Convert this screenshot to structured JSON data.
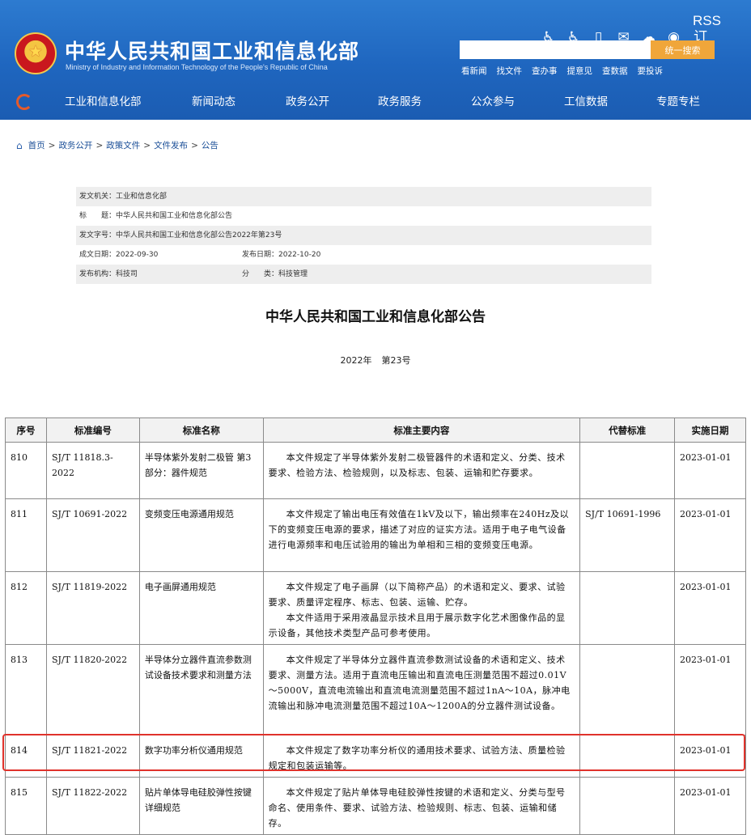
{
  "header": {
    "title": "中华人民共和国工业和信息化部",
    "subtitle": "Ministry of Industry and Information Technology of the People's Republic of China",
    "tool_icons": [
      "accessibility-icon",
      "wheelchair-icon",
      "mobile-icon",
      "mail-icon",
      "wechat-icon",
      "weibo-icon"
    ],
    "rss_label": "RSS订阅",
    "search_placeholder": "",
    "search_button": "统一搜索",
    "quick_links": [
      "看新闻",
      "找文件",
      "查办事",
      "提意见",
      "查数据",
      "要投诉"
    ],
    "nav": [
      "工业和信息化部",
      "新闻动态",
      "政务公开",
      "政务服务",
      "公众参与",
      "工信数据",
      "专题专栏"
    ]
  },
  "breadcrumb": [
    "首页",
    "政务公开",
    "政策文件",
    "文件发布",
    "公告"
  ],
  "meta": {
    "issuer": "发文机关：工业和信息化部",
    "subject": "标　　题：中华人民共和国工业和信息化部公告",
    "doc_no": "发文字号：中华人民共和国工业和信息化部公告2022年第23号",
    "created": "成文日期：2022-09-30",
    "published": "发布日期：2022-10-20",
    "org": "发布机构：科技司",
    "category": "分　　类：科技管理"
  },
  "doc": {
    "title": "中华人民共和国工业和信息化部公告",
    "year": "2022年",
    "number": "第23号"
  },
  "table": {
    "headers": [
      "序号",
      "标准编号",
      "标准名称",
      "标准主要内容",
      "代替标准",
      "实施日期"
    ],
    "rows": [
      {
        "no": "810",
        "code": "SJ/T 11818.3-2022",
        "name": "半导体紫外发射二极管 第3部分：器件规范",
        "content": [
          "本文件规定了半导体紫外发射二极管器件的术语和定义、分类、技术要求、检验方法、检验规则，以及标志、包装、运输和贮存要求。"
        ],
        "replaces": "",
        "date": "2023-01-01"
      },
      {
        "no": "811",
        "code": "SJ/T 10691-2022",
        "name": "变频变压电源通用规范",
        "content": [
          "本文件规定了输出电压有效值在1kV及以下，输出频率在240Hz及以下的变频变压电源的要求，描述了对应的证实方法。适用于电子电气设备进行电源频率和电压试验用的输出为单相和三相的变频变压电源。"
        ],
        "replaces": "SJ/T 10691-1996",
        "date": "2023-01-01"
      },
      {
        "no": "812",
        "code": "SJ/T 11819-2022",
        "name": "电子画屏通用规范",
        "content": [
          "本文件规定了电子画屏（以下简称产品）的术语和定义、要求、试验要求、质量评定程序、标志、包装、运输、贮存。",
          "本文件适用于采用液晶显示技术且用于展示数字化艺术图像作品的显示设备，其他技术类型产品可参考使用。"
        ],
        "replaces": "",
        "date": "2023-01-01"
      },
      {
        "no": "813",
        "code": "SJ/T 11820-2022",
        "name": "半导体分立器件直流参数测试设备技术要求和测量方法",
        "content": [
          "本文件规定了半导体分立器件直流参数测试设备的术语和定义、技术要求、测量方法。适用于直流电压输出和直流电压测量范围不超过0.01V～5000V，直流电流输出和直流电流测量范围不超过1nA～10A，脉冲电流输出和脉冲电流测量范围不超过10A～1200A的分立器件测试设备。"
        ],
        "replaces": "",
        "date": "2023-01-01"
      },
      {
        "no": "814",
        "code": "SJ/T 11821-2022",
        "name": "数字功率分析仪通用规范",
        "content": [
          "本文件规定了数字功率分析仪的通用技术要求、试验方法、质量检验规定和包装运输等。"
        ],
        "replaces": "",
        "date": "2023-01-01"
      },
      {
        "no": "815",
        "code": "SJ/T 11822-2022",
        "name": "贴片单体导电硅胶弹性按键详细规范",
        "content": [
          "本文件规定了贴片单体导电硅胶弹性按键的术语和定义、分类与型号命名、使用条件、要求、试验方法、检验规则、标志、包装、运输和储存。"
        ],
        "replaces": "",
        "date": "2023-01-01"
      }
    ]
  }
}
